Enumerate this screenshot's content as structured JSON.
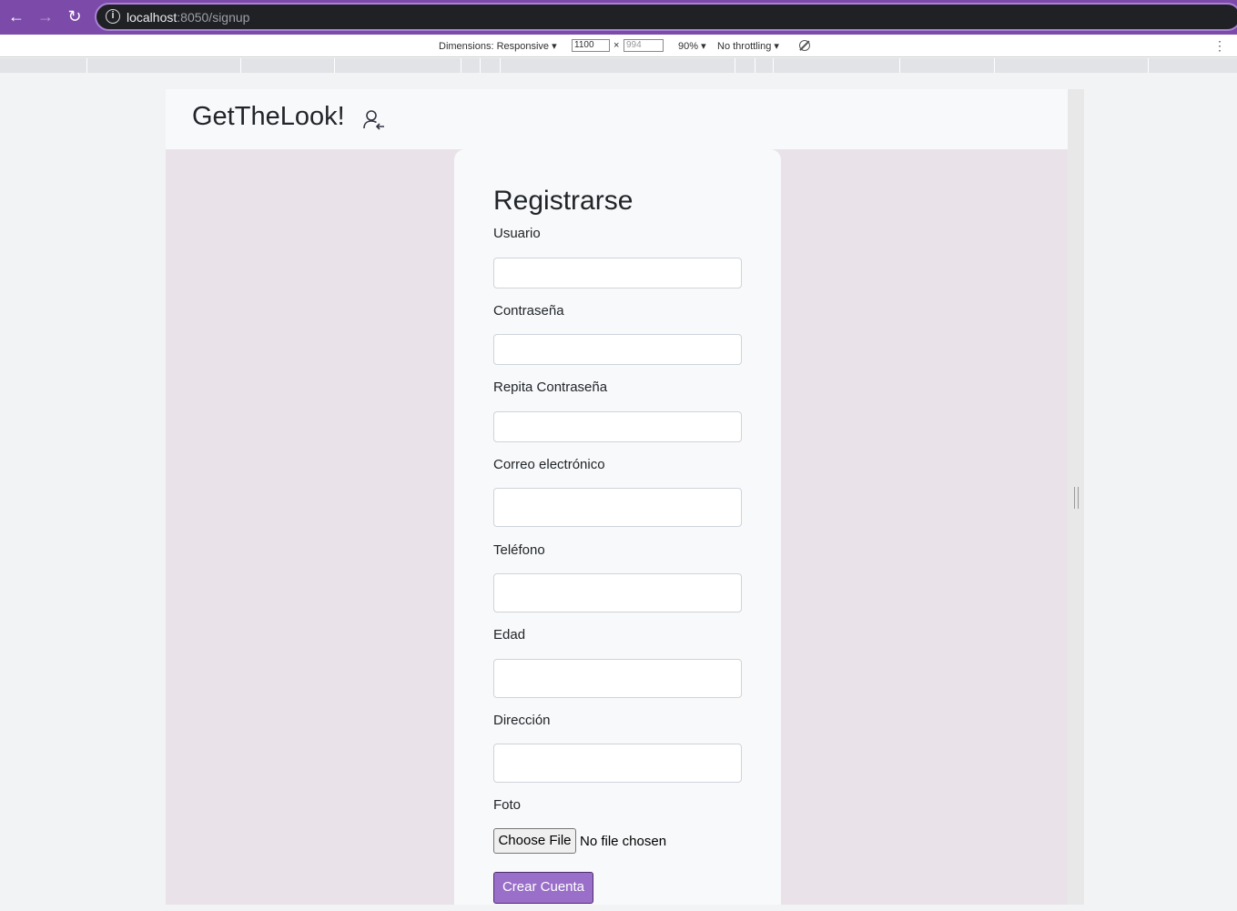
{
  "browser": {
    "url_host": "localhost",
    "url_path": ":8050/signup"
  },
  "device_toolbar": {
    "dimensions_label": "Dimensions: Responsive ▾",
    "width_value": "1100",
    "times": "×",
    "height_placeholder": "994",
    "zoom": "90% ▾",
    "throttling": "No throttling ▾"
  },
  "navbar": {
    "brand": "GetTheLook!"
  },
  "form": {
    "title": "Registrarse",
    "fields": [
      {
        "label": "Usuario"
      },
      {
        "label": "Contraseña"
      },
      {
        "label": "Repita Contraseña"
      },
      {
        "label": "Correo electrónico"
      },
      {
        "label": "Teléfono"
      },
      {
        "label": "Edad"
      },
      {
        "label": "Dirección"
      }
    ],
    "photo_label": "Foto",
    "file_button": "Choose File",
    "file_status": "No file chosen",
    "submit": "Crear Cuenta"
  },
  "colors": {
    "browser_accent": "#7c4aa8",
    "page_background": "#e9e3e9",
    "submit_button": "#9a6fc9"
  },
  "icons": [
    "back-arrow-icon",
    "forward-arrow-icon",
    "reload-icon",
    "info-icon",
    "rotate-icon",
    "kebab-menu-icon",
    "user-login-icon"
  ]
}
